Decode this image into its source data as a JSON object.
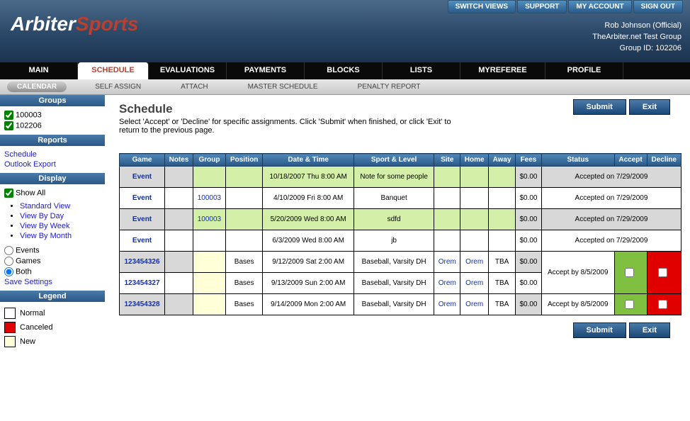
{
  "topLinks": {
    "switch": "SWITCH VIEWS",
    "support": "SUPPORT",
    "account": "MY ACCOUNT",
    "signout": "SIGN OUT"
  },
  "logo": {
    "part1": "Arbiter",
    "part2": "Sports"
  },
  "userInfo": {
    "name": "Rob Johnson (Official)",
    "group": "TheArbiter.net Test Group",
    "groupId": "Group ID: 102206"
  },
  "mainNav": {
    "main": "MAIN",
    "schedule": "SCHEDULE",
    "evaluations": "EVALUATIONS",
    "payments": "PAYMENTS",
    "blocks": "BLOCKS",
    "lists": "LISTS",
    "myreferee": "MYREFEREE",
    "profile": "PROFILE"
  },
  "subNav": {
    "calendar": "CALENDAR",
    "selfAssign": "SELF ASSIGN",
    "attach": "ATTACH",
    "master": "MASTER SCHEDULE",
    "penalty": "PENALTY REPORT"
  },
  "sidebar": {
    "groupsHeader": "Groups",
    "groups": {
      "g1": "100003",
      "g2": "102206"
    },
    "reportsHeader": "Reports",
    "reports": {
      "schedule": "Schedule",
      "outlook": "Outlook Export"
    },
    "displayHeader": "Display",
    "showAll": "Show All",
    "views": {
      "standard": "Standard View",
      "day": "View By Day",
      "week": "View By Week",
      "month": "View By Month"
    },
    "radio": {
      "events": "Events",
      "games": "Games",
      "both": "Both"
    },
    "saveSettings": "Save Settings",
    "legendHeader": "Legend",
    "legend": {
      "normal": "Normal",
      "canceled": "Canceled",
      "new": "New"
    }
  },
  "page": {
    "title": "Schedule",
    "desc": "Select 'Accept' or 'Decline' for specific assignments. Click 'Submit' when finished, or click 'Exit' to return to the previous page.",
    "submit": "Submit",
    "exit": "Exit"
  },
  "columns": {
    "game": "Game",
    "notes": "Notes",
    "group": "Group",
    "position": "Position",
    "datetime": "Date & Time",
    "sportlevel": "Sport & Level",
    "site": "Site",
    "home": "Home",
    "away": "Away",
    "fees": "Fees",
    "status": "Status",
    "accept": "Accept",
    "decline": "Decline"
  },
  "rows": {
    "r0": {
      "game": "Event",
      "group": "",
      "datetime": "10/18/2007 Thu 8:00 AM",
      "sportlevel": "Note for some people",
      "fees": "$0.00",
      "status": "Accepted on 7/29/2009"
    },
    "r1": {
      "game": "Event",
      "group": "100003",
      "datetime": "4/10/2009 Fri 8:00 AM",
      "sportlevel": "Banquet",
      "fees": "$0.00",
      "status": "Accepted on 7/29/2009"
    },
    "r2": {
      "game": "Event",
      "group": "100003",
      "datetime": "5/20/2009 Wed 8:00 AM",
      "sportlevel": "sdfd",
      "fees": "$0.00",
      "status": "Accepted on 7/29/2009"
    },
    "r3": {
      "game": "Event",
      "group": "",
      "datetime": "6/3/2009 Wed 8:00 AM",
      "sportlevel": "jb",
      "fees": "$0.00",
      "status": "Accepted on 7/29/2009"
    },
    "r4": {
      "game": "123454326",
      "position": "Bases",
      "datetime": "9/12/2009 Sat 2:00 AM",
      "sportlevel": "Baseball, Varsity DH",
      "site": "Orem",
      "home": "Orem",
      "away": "TBA",
      "fees": "$0.00",
      "status": "Accept by 8/5/2009"
    },
    "r5": {
      "game": "123454327",
      "position": "Bases",
      "datetime": "9/13/2009 Sun 2:00 AM",
      "sportlevel": "Baseball, Varsity DH",
      "site": "Orem",
      "home": "Orem",
      "away": "TBA",
      "fees": "$0.00"
    },
    "r6": {
      "game": "123454328",
      "position": "Bases",
      "datetime": "9/14/2009 Mon 2:00 AM",
      "sportlevel": "Baseball, Varsity DH",
      "site": "Orem",
      "home": "Orem",
      "away": "TBA",
      "fees": "$0.00",
      "status": "Accept by 8/5/2009"
    }
  },
  "colors": {
    "normal": "#ffffff",
    "canceled": "#e00000",
    "new": "#ffffd8"
  }
}
